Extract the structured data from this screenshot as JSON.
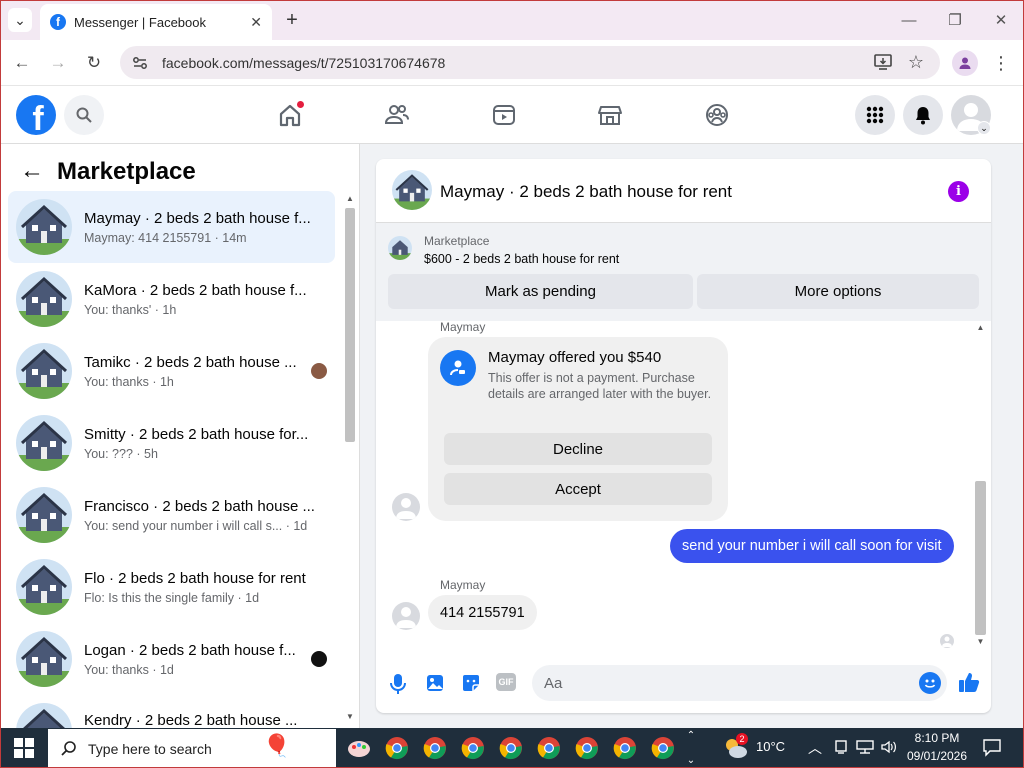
{
  "browser": {
    "tab_title": "Messenger | Facebook",
    "url": "facebook.com/messages/t/725103170674678"
  },
  "left_panel": {
    "title": "Marketplace",
    "conversations": [
      {
        "name": "Maymay · 2 beds 2 bath house f...",
        "preview": "Maymay: 414 2155791 · 14m",
        "active": true
      },
      {
        "name": "KaMora · 2 beds 2 bath house f...",
        "preview": "You: thanks' · 1h"
      },
      {
        "name": "Tamikc · 2 beds 2 bath house ...",
        "preview": "You: thanks · 1h"
      },
      {
        "name": "Smitty · 2 beds 2 bath house for...",
        "preview": "You: ??? · 5h"
      },
      {
        "name": "Francisco · 2 beds 2 bath house ...",
        "preview": "You: send your number i will call s...  · 1d"
      },
      {
        "name": "Flo · 2 beds 2 bath house for rent",
        "preview": "Flo: Is this the single family · 1d"
      },
      {
        "name": "Logan · 2 beds 2 bath house f...",
        "preview": "You: thanks · 1d"
      },
      {
        "name": "Kendry · 2 beds 2 bath house ...",
        "preview": ""
      }
    ]
  },
  "chat": {
    "title": "Maymay · 2 beds 2 bath house for rent",
    "listing_label": "Marketplace",
    "listing_title": "$600 - 2 beds 2 bath house for rent",
    "mark_pending": "Mark as pending",
    "more_options": "More options",
    "offer_sender": "Maymay",
    "offer_title": "Maymay offered you $540",
    "offer_body": "This offer is not a payment. Purchase details are arranged later with the buyer.",
    "decline": "Decline",
    "accept": "Accept",
    "outgoing_message": "send your number i will call soon for visit",
    "reply_sender": "Maymay",
    "reply_message": "414 2155791",
    "composer_placeholder": "Aa"
  },
  "taskbar": {
    "search_placeholder": "Type here to search",
    "weather": "10°C",
    "time": "8:10 PM",
    "date": "09/01/2026",
    "notification_badge": "2"
  },
  "colors": {
    "fb_blue": "#1877f2",
    "messenger_blue": "#3a52ee",
    "info_purple": "#9b00e8"
  }
}
